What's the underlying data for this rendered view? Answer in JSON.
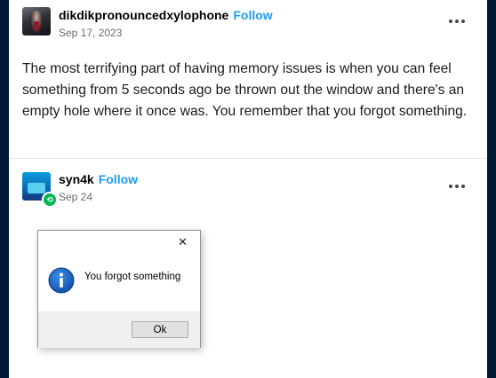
{
  "posts": [
    {
      "username": "dikdikpronouncedxylophone",
      "follow_label": "Follow",
      "date": "Sep 17, 2023",
      "text": "The most terrifying part of having memory issues is when you can feel something from 5 seconds ago be thrown out the window and there's an empty hole where it once was. You remember that you forgot something."
    },
    {
      "username": "syn4k",
      "follow_label": "Follow",
      "date": "Sep 24",
      "badge_icon": "repost-icon",
      "dialog": {
        "close_glyph": "✕",
        "icon": "info-icon",
        "message": "You forgot something",
        "ok_label": "Ok"
      }
    }
  ],
  "colors": {
    "background": "#001935",
    "card": "#ffffff",
    "follow": "#1f9bf0",
    "badge": "#00b84f",
    "info_icon": "#1565c0"
  }
}
